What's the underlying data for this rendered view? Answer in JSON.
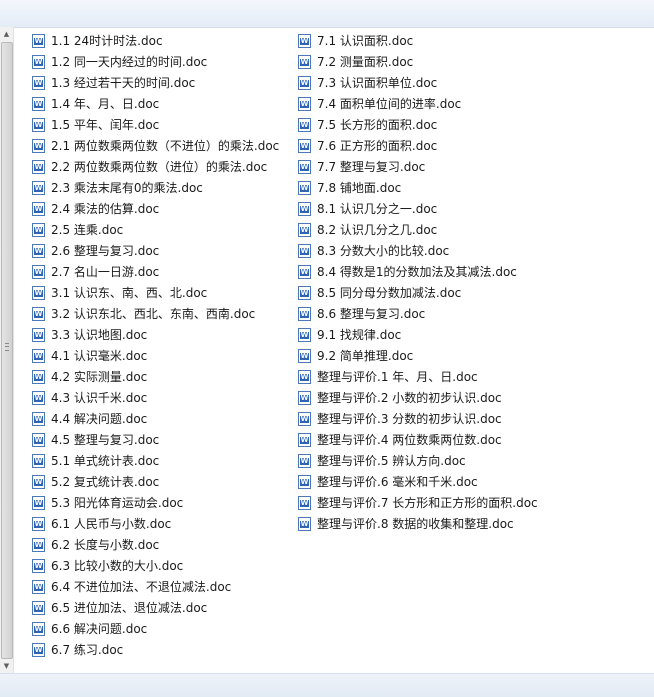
{
  "column1": [
    {
      "name": "1.1 24时计时法.doc",
      "icon": "word-document-icon"
    },
    {
      "name": "1.2 同一天内经过的时间.doc",
      "icon": "word-document-icon"
    },
    {
      "name": "1.3 经过若干天的时间.doc",
      "icon": "word-document-icon"
    },
    {
      "name": "1.4 年、月、日.doc",
      "icon": "word-document-icon"
    },
    {
      "name": "1.5 平年、闰年.doc",
      "icon": "word-document-icon"
    },
    {
      "name": "2.1 两位数乘两位数（不进位）的乘法.doc",
      "icon": "word-document-icon"
    },
    {
      "name": "2.2 两位数乘两位数（进位）的乘法.doc",
      "icon": "word-document-icon"
    },
    {
      "name": "2.3 乘法末尾有0的乘法.doc",
      "icon": "word-document-icon"
    },
    {
      "name": "2.4 乘法的估算.doc",
      "icon": "word-document-icon"
    },
    {
      "name": "2.5 连乘.doc",
      "icon": "word-document-icon"
    },
    {
      "name": "2.6 整理与复习.doc",
      "icon": "word-document-icon"
    },
    {
      "name": "2.7 名山一日游.doc",
      "icon": "word-document-icon"
    },
    {
      "name": "3.1 认识东、南、西、北.doc",
      "icon": "word-document-icon"
    },
    {
      "name": "3.2 认识东北、西北、东南、西南.doc",
      "icon": "word-document-icon"
    },
    {
      "name": "3.3 认识地图.doc",
      "icon": "word-document-icon"
    },
    {
      "name": "4.1 认识毫米.doc",
      "icon": "word-document-icon"
    },
    {
      "name": "4.2 实际测量.doc",
      "icon": "word-document-icon"
    },
    {
      "name": "4.3 认识千米.doc",
      "icon": "word-document-icon"
    },
    {
      "name": "4.4 解决问题.doc",
      "icon": "word-document-icon"
    },
    {
      "name": "4.5 整理与复习.doc",
      "icon": "word-document-icon"
    },
    {
      "name": "5.1 单式统计表.doc",
      "icon": "word-document-icon"
    },
    {
      "name": "5.2 复式统计表.doc",
      "icon": "word-document-icon"
    },
    {
      "name": "5.3 阳光体育运动会.doc",
      "icon": "word-document-icon"
    },
    {
      "name": "6.1 人民币与小数.doc",
      "icon": "word-document-icon"
    },
    {
      "name": "6.2 长度与小数.doc",
      "icon": "word-document-icon"
    },
    {
      "name": "6.3 比较小数的大小.doc",
      "icon": "word-document-icon"
    },
    {
      "name": "6.4 不进位加法、不退位减法.doc",
      "icon": "word-document-icon"
    },
    {
      "name": "6.5 进位加法、退位减法.doc",
      "icon": "word-document-icon"
    },
    {
      "name": "6.6 解决问题.doc",
      "icon": "word-document-icon"
    },
    {
      "name": "6.7 练习.doc",
      "icon": "word-document-icon"
    }
  ],
  "column2": [
    {
      "name": "7.1 认识面积.doc",
      "icon": "word-document-icon"
    },
    {
      "name": "7.2 测量面积.doc",
      "icon": "word-document-icon"
    },
    {
      "name": "7.3 认识面积单位.doc",
      "icon": "word-document-icon"
    },
    {
      "name": "7.4 面积单位间的进率.doc",
      "icon": "word-document-icon"
    },
    {
      "name": "7.5 长方形的面积.doc",
      "icon": "word-document-icon"
    },
    {
      "name": "7.6 正方形的面积.doc",
      "icon": "word-document-icon"
    },
    {
      "name": "7.7 整理与复习.doc",
      "icon": "word-document-icon"
    },
    {
      "name": "7.8 铺地面.doc",
      "icon": "word-document-icon"
    },
    {
      "name": "8.1 认识几分之一.doc",
      "icon": "word-document-icon"
    },
    {
      "name": "8.2 认识几分之几.doc",
      "icon": "word-document-icon"
    },
    {
      "name": "8.3 分数大小的比较.doc",
      "icon": "word-document-icon"
    },
    {
      "name": "8.4 得数是1的分数加法及其减法.doc",
      "icon": "word-document-icon"
    },
    {
      "name": "8.5 同分母分数加减法.doc",
      "icon": "word-document-icon"
    },
    {
      "name": "8.6 整理与复习.doc",
      "icon": "word-document-icon"
    },
    {
      "name": "9.1 找规律.doc",
      "icon": "word-document-icon"
    },
    {
      "name": "9.2 简单推理.doc",
      "icon": "word-document-icon"
    },
    {
      "name": "整理与评价.1 年、月、日.doc",
      "icon": "word-document-icon"
    },
    {
      "name": "整理与评价.2 小数的初步认识.doc",
      "icon": "word-document-icon"
    },
    {
      "name": "整理与评价.3 分数的初步认识.doc",
      "icon": "word-document-icon"
    },
    {
      "name": "整理与评价.4 两位数乘两位数.doc",
      "icon": "word-document-icon"
    },
    {
      "name": "整理与评价.5 辨认方向.doc",
      "icon": "word-document-icon"
    },
    {
      "name": "整理与评价.6 毫米和千米.doc",
      "icon": "word-document-icon"
    },
    {
      "name": "整理与评价.7 长方形和正方形的面积.doc",
      "icon": "word-document-icon"
    },
    {
      "name": "整理与评价.8 数据的收集和整理.doc",
      "icon": "word-document-icon"
    }
  ],
  "scrollbar": {
    "up_icon": "scroll-up-arrow-icon",
    "down_icon": "scroll-down-arrow-icon"
  }
}
